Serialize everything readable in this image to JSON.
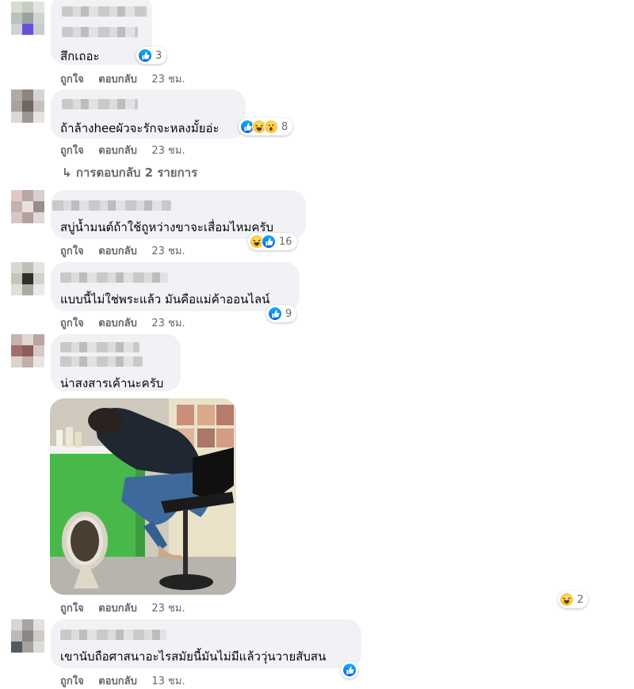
{
  "actions": {
    "like": "ถูกใจ",
    "reply": "ตอบกลับ"
  },
  "comments": [
    {
      "text": "สึกเถอะ",
      "time": "23 ชม.",
      "reaction_count": "3",
      "reactions": [
        "like"
      ]
    },
    {
      "text": "ถ้าล้างheeผัวจะรักจะหลงมั้ยอ่ะ",
      "time": "23 ชม.",
      "reaction_count": "8",
      "reactions": [
        "like",
        "haha",
        "wow"
      ],
      "replies_label": "การตอบกลับ 2 รายการ"
    },
    {
      "text": "สบู่น้ำมนต์ถ้าใช้ถูหว่างขาจะเสื่อมไหมครับ",
      "time": "23 ชม.",
      "reaction_count": "16",
      "reactions": [
        "haha",
        "like"
      ]
    },
    {
      "text": "แบบนี้ไม่ใช่พระแล้ว มันคือแม่ค้าออนไลน์",
      "time": "23 ชม.",
      "reaction_count": "9",
      "reactions": [
        "like"
      ]
    },
    {
      "text": "น่าสงสารเค้านะครับ",
      "time": "23 ชม.",
      "reaction_count": "2",
      "reactions": [
        "haha"
      ],
      "has_photo": true
    },
    {
      "text": "เขานับถือศาสนาอะไรสมัยนี้มันไม่มีแล้ววุ่นวายสับสน",
      "time": "13 ชม.",
      "reaction_count": "",
      "reactions": [
        "like"
      ]
    }
  ],
  "colors": {
    "bubble": "#f0f2f5",
    "meta_text": "#65676b",
    "like_blue": "#1877f2",
    "haha_yellow": "#f7b125"
  }
}
